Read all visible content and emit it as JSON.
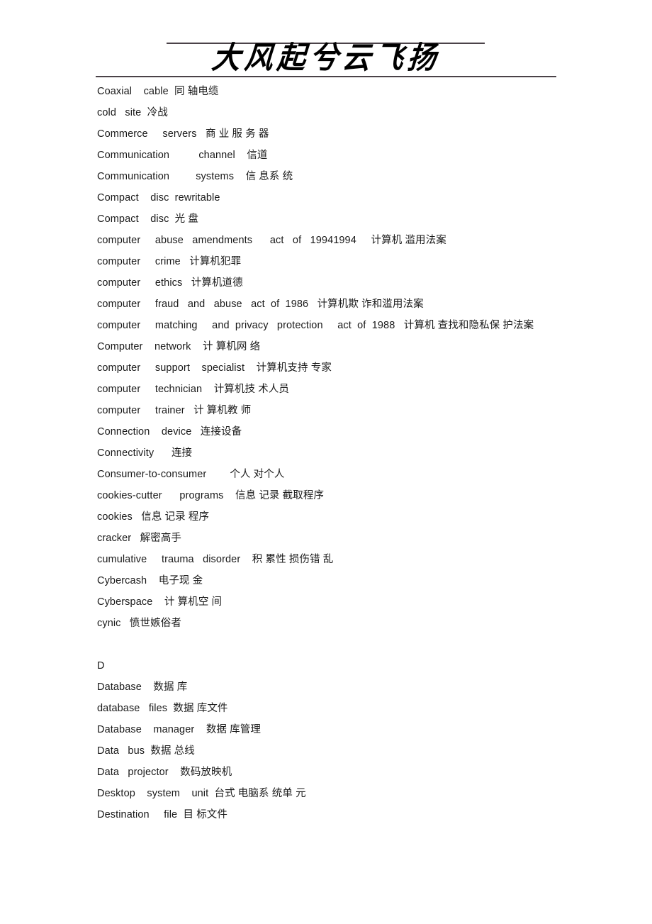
{
  "document": {
    "header": {
      "title": "大风起兮云飞扬",
      "rule_top": "horizontal-rule",
      "rule_bottom": "horizontal-rule"
    },
    "entries": [
      {
        "text": "Coaxial    cable  同 轴电缆"
      },
      {
        "text": "cold   site  冷战"
      },
      {
        "text": "Commerce     servers   商 业 服 务 器"
      },
      {
        "text": "Communication          channel    信道"
      },
      {
        "text": "Communication         systems    信 息系 统"
      },
      {
        "text": "Compact    disc  rewritable"
      },
      {
        "text": "Compact    disc  光 盘"
      },
      {
        "text": "computer     abuse   amendments      act   of   19941994     计算机 滥用法案"
      },
      {
        "text": "computer     crime   计算机犯罪"
      },
      {
        "text": "computer     ethics   计算机道德"
      },
      {
        "text": "computer     fraud   and   abuse   act  of  1986   计算机欺 诈和滥用法案"
      },
      {
        "text": "computer     matching     and  privacy   protection     act  of  1988   计算机 查找和隐私保 护法案"
      },
      {
        "text": "Computer    network    计 算机网 络"
      },
      {
        "text": "computer     support    specialist    计算机支持 专家"
      },
      {
        "text": "computer     technician    计算机技 术人员"
      },
      {
        "text": "computer     trainer   计 算机教 师"
      },
      {
        "text": "Connection    device   连接设备"
      },
      {
        "text": "Connectivity      连接"
      },
      {
        "text": "Consumer-to-consumer        个人 对个人"
      },
      {
        "text": "cookies-cutter      programs    信息 记录 截取程序"
      },
      {
        "text": "cookies   信息 记录 程序"
      },
      {
        "text": "cracker   解密高手"
      },
      {
        "text": "cumulative     trauma   disorder    积 累性 损伤错 乱"
      },
      {
        "text": "Cybercash    电子现 金"
      },
      {
        "text": "Cyberspace    计 算机空 间"
      },
      {
        "text": "cynic   愤世嫉俗者"
      },
      {
        "text": ""
      },
      {
        "text": "D"
      },
      {
        "text": "Database    数据 库"
      },
      {
        "text": "database   files  数据 库文件"
      },
      {
        "text": "Database    manager    数据 库管理"
      },
      {
        "text": "Data   bus  数据 总线"
      },
      {
        "text": "Data   projector    数码放映机"
      },
      {
        "text": "Desktop    system    unit  台式 电脑系 统单 元"
      },
      {
        "text": "Destination     file  目 标文件"
      }
    ]
  }
}
